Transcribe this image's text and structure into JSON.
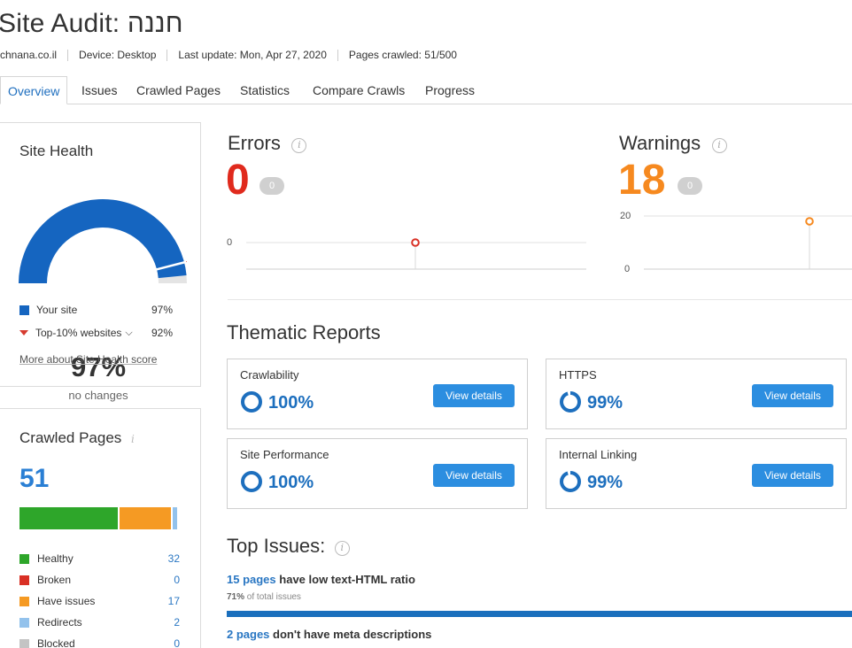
{
  "header": {
    "title": "Site Audit: חננה",
    "domain": "chnana.co.il",
    "device": "Device: Desktop",
    "last_update": "Last update: Mon, Apr 27, 2020",
    "pages_crawled": "Pages crawled: 51/500"
  },
  "tabs": [
    "Overview",
    "Issues",
    "Crawled Pages",
    "Statistics",
    "Compare Crawls",
    "Progress"
  ],
  "site_health": {
    "title": "Site Health",
    "percent": "97%",
    "percent_value": 97,
    "subtitle": "no changes",
    "legend": [
      {
        "label": "Your site",
        "value": "97%",
        "color": "#1565c0"
      },
      {
        "label": "Top-10% websites",
        "value": "92%",
        "color": "#d63b2f"
      }
    ],
    "top10_marker": 92,
    "more_link": "More about Site Health score"
  },
  "crawled_pages": {
    "title": "Crawled Pages",
    "total": "51",
    "categories": [
      {
        "label": "Healthy",
        "value": "32",
        "count": 32,
        "color": "#2ea62a"
      },
      {
        "label": "Broken",
        "value": "0",
        "count": 0,
        "color": "#d93025"
      },
      {
        "label": "Have issues",
        "value": "17",
        "count": 17,
        "color": "#f59a23"
      },
      {
        "label": "Redirects",
        "value": "2",
        "count": 2,
        "color": "#93c2ec"
      },
      {
        "label": "Blocked",
        "value": "0",
        "count": 0,
        "color": "#c4c4c4"
      }
    ]
  },
  "errors": {
    "title": "Errors",
    "value": "0",
    "delta": "0",
    "color": "#e02a1d",
    "axis": [
      "0"
    ],
    "point": 0
  },
  "warnings": {
    "title": "Warnings",
    "value": "18",
    "delta": "0",
    "color": "#f6891f",
    "axis": [
      "20",
      "0"
    ],
    "point": 18,
    "axis_max": 20
  },
  "thematic": {
    "title": "Thematic Reports",
    "button_label": "View details",
    "reports": [
      {
        "name": "Crawlability",
        "percent": "100%",
        "value": 100
      },
      {
        "name": "HTTPS",
        "percent": "99%",
        "value": 99
      },
      {
        "name": "Site Performance",
        "percent": "100%",
        "value": 100
      },
      {
        "name": "Internal Linking",
        "percent": "99%",
        "value": 99
      }
    ]
  },
  "top_issues": {
    "title": "Top Issues:",
    "items": [
      {
        "link": "15 pages",
        "text": " have low text-HTML ratio",
        "pct": "71%",
        "sub": " of total issues",
        "value": 71
      },
      {
        "link": "2 pages",
        "text": " don't have meta descriptions"
      }
    ]
  }
}
